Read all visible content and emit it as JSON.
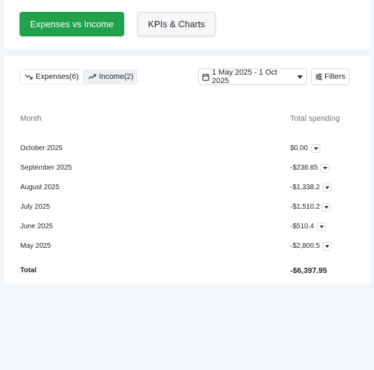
{
  "top_tabs": {
    "expenses_vs_income": "Expenses vs Income",
    "kpis_charts": "KPIs & Charts"
  },
  "toolbar": {
    "expenses_toggle": "Expenses(6)",
    "income_toggle": "Income(2)",
    "date_range": "1 May 2025 - 1 Oct 2025",
    "filters": "Filters"
  },
  "table": {
    "headers": {
      "month": "Month",
      "total": "Total spending"
    },
    "rows": [
      {
        "month": "October  2025",
        "amount": "$0.00"
      },
      {
        "month": "September 2025",
        "amount": "-$238.65"
      },
      {
        "month": "August 2025",
        "amount": "-$1,338.2"
      },
      {
        "month": "July 2025",
        "amount": "-$1,510.2"
      },
      {
        "month": "June 2025",
        "amount": "-$510.4"
      },
      {
        "month": "May 2025",
        "amount": "-$2,800.5"
      }
    ],
    "total": {
      "label": "Total",
      "amount": "-$6,397.95"
    }
  },
  "colors": {
    "primary": "#1fa24a",
    "background": "#f3f6f9"
  }
}
